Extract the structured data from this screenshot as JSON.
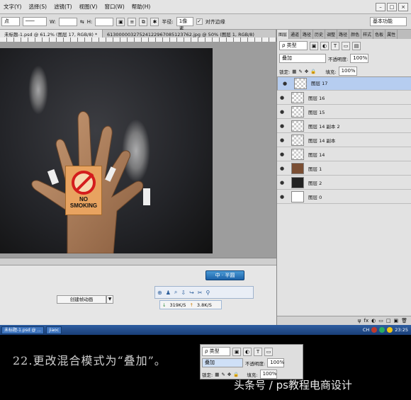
{
  "menu": {
    "items": [
      "文字(Y)",
      "选择(S)",
      "滤镜(T)",
      "视图(V)",
      "窗口(W)",
      "帮助(H)"
    ],
    "window_controls": [
      "–",
      "□",
      "×"
    ]
  },
  "options_bar": {
    "point_select": "点",
    "w_label": "W:",
    "h_label": "H:",
    "radius_label": "半径:",
    "radius_value": "1像素",
    "align_edges_label": "对齐边缘",
    "workspace": "基本功能"
  },
  "tabs": [
    "未标题-1.psd @ 61.2% (图层 17, RGB/8) *",
    "613000003275241229670851237​62.jpg @ 50% (图层 1, RGB/8)"
  ],
  "canvas_sign": {
    "line1": "NO",
    "line2": "SMOKING"
  },
  "timeline": {
    "create_button": "创建帧动画",
    "dropdown_icon": "▼"
  },
  "network": {
    "toolbar_label": "中 · 半圆",
    "download": "319K/S",
    "upload": "3.8K/S",
    "icons": [
      "zoom-icon",
      "user-icon",
      "search-icon",
      "download-icon",
      "share-icon",
      "scissors-icon",
      "pin-icon"
    ]
  },
  "layers_panel": {
    "panel_tabs": [
      "图层",
      "通道",
      "路径",
      "历史",
      "调整",
      "路径",
      "颜色",
      "样式",
      "色板",
      "属性"
    ],
    "kind_label": "ρ 类型",
    "blend_mode": "叠加",
    "opacity_label": "不透明度:",
    "opacity_value": "100%",
    "lock_label": "锁定:",
    "fill_label": "填充:",
    "fill_value": "100%",
    "layers": [
      {
        "name": "图层 17",
        "selected": true
      },
      {
        "name": "图层 16",
        "selected": false
      },
      {
        "name": "图层 15",
        "selected": false
      },
      {
        "name": "图层 14 副本 2",
        "selected": false
      },
      {
        "name": "图层 14 副本",
        "selected": false
      },
      {
        "name": "图层 14",
        "selected": false
      },
      {
        "name": "图层 1",
        "selected": false
      },
      {
        "name": "图层 2",
        "selected": false
      },
      {
        "name": "图层 0",
        "selected": false
      }
    ],
    "bottom_icons": [
      "ψ",
      "fx",
      "◐",
      "▭",
      "□",
      "▣",
      "🗑"
    ]
  },
  "taskbar": {
    "items": [
      "未标题-1.psd @ ...",
      "jiaoc"
    ],
    "tray_label": "CH",
    "time": "23:25"
  },
  "caption": "22.更改混合模式为“叠加”。",
  "mini_panel": {
    "kind_label": "ρ 类型",
    "blend_mode": "叠加",
    "opacity_label": "不透明度:",
    "opacity_value": "100%",
    "lock_label": "锁定:",
    "fill_label": "填充:",
    "fill_value": "100%"
  },
  "watermark": "头条号 / ps教程电商设计"
}
